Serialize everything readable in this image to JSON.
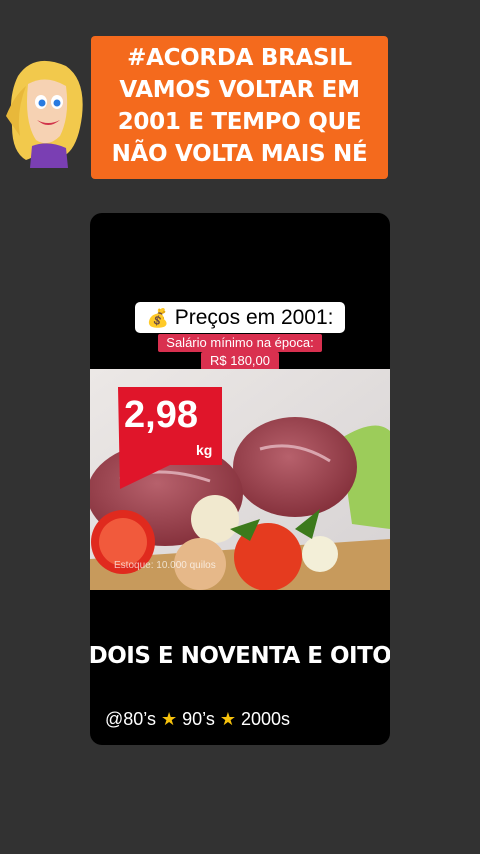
{
  "headline": {
    "lines": [
      "#ACORDA BRASIL",
      "VAMOS VOLTAR EM",
      "2001 E TEMPO QUE",
      "NÃO VOLTA MAIS NÉ"
    ]
  },
  "video": {
    "price_icon": "💰",
    "price_title": "Preços em 2001:",
    "salary_line1": "Salário mínimo na época:",
    "salary_line2": "R$ 180,00",
    "tag_price": "2,98",
    "tag_unit": "kg",
    "stock_text": "Estoque: 10.000 quilos",
    "caption": "DOIS E NOVENTA E OITO",
    "handle_a": "@80’s",
    "handle_b": "90’s",
    "handle_c": "2000s",
    "star": "★"
  },
  "colors": {
    "background": "#323232",
    "headline_bg": "#f46a1d",
    "salary_bg": "#d9304f",
    "tag_red": "#e0152a"
  }
}
